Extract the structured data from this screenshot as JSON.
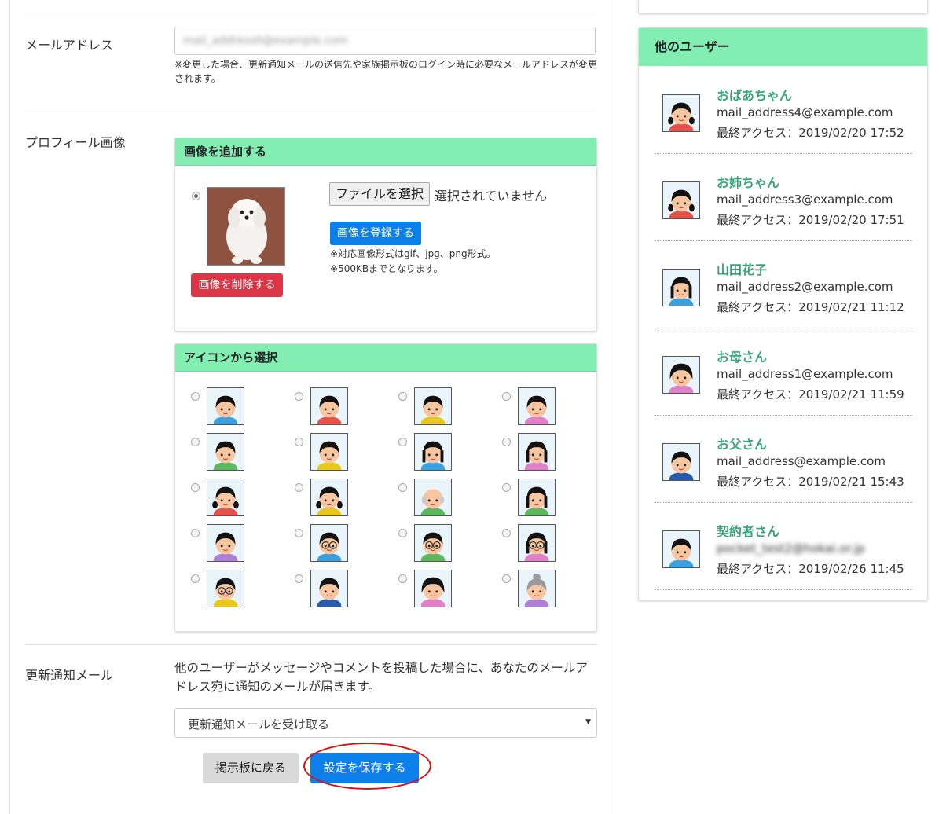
{
  "form": {
    "email": {
      "label": "メールアドレス",
      "value": "mail_address0@example.com",
      "note": "※変更した場合、更新通知メールの送信先や家族掲示板のログイン時に必要なメールアドレスが変更されます。"
    },
    "profile_image": {
      "label": "プロフィール画像",
      "upload_panel": {
        "title": "画像を追加する",
        "delete_button": "画像を削除する",
        "file_button": "ファイルを選択",
        "file_status": "選択されていません",
        "register_button": "画像を登録する",
        "note_formats": "※対応画像形式はgif、jpg、png形式。",
        "note_size": "※500KBまでとなります。"
      },
      "icon_panel": {
        "title": "アイコンから選択",
        "icons": [
          {
            "name": "boy-blue",
            "hair": "#111",
            "shirt": "#3aa0e0",
            "face": "#f6c6a0"
          },
          {
            "name": "boy-red",
            "hair": "#111",
            "shirt": "#e8504a",
            "face": "#f6c6a0"
          },
          {
            "name": "girl-bob-yellow",
            "hair": "#111",
            "shirt": "#e8c81a",
            "face": "#f6c6a0"
          },
          {
            "name": "girl-pink",
            "hair": "#111",
            "shirt": "#e080c8",
            "face": "#f6c6a0"
          },
          {
            "name": "boy-spiky-green",
            "hair": "#111",
            "shirt": "#5cb85c",
            "face": "#f6c6a0"
          },
          {
            "name": "boy-spiky-yellow",
            "hair": "#111",
            "shirt": "#e8c81a",
            "face": "#f6c6a0"
          },
          {
            "name": "girl-long-blue",
            "hair": "#111",
            "shirt": "#3aa0e0",
            "face": "#f6c6a0"
          },
          {
            "name": "girl-long-pink",
            "hair": "#111",
            "shirt": "#e080c8",
            "face": "#f6c6a0"
          },
          {
            "name": "girl-pigtails-red",
            "hair": "#111",
            "shirt": "#e8504a",
            "face": "#f6c6a0"
          },
          {
            "name": "girl-pigtails-yellow",
            "hair": "#111",
            "shirt": "#e8c81a",
            "face": "#f6c6a0"
          },
          {
            "name": "grandpa-green",
            "hair": "#ccc",
            "shirt": "#5cb85c",
            "face": "#f6c6a0"
          },
          {
            "name": "woman-green",
            "hair": "#111",
            "shirt": "#5cb85c",
            "face": "#f6c6a0"
          },
          {
            "name": "girl-side-purple",
            "hair": "#111",
            "shirt": "#b080d8",
            "face": "#f6c6a0"
          },
          {
            "name": "boy-glasses-blue",
            "hair": "#111",
            "shirt": "#3aa0e0",
            "face": "#f6c6a0"
          },
          {
            "name": "boy-glasses-green",
            "hair": "#111",
            "shirt": "#5cb85c",
            "face": "#f6c6a0"
          },
          {
            "name": "woman-glasses-pink",
            "hair": "#111",
            "shirt": "#e080c8",
            "face": "#f6c6a0"
          },
          {
            "name": "girl-glasses-yellow",
            "hair": "#111",
            "shirt": "#e8c81a",
            "face": "#f6c6a0"
          },
          {
            "name": "man-suit",
            "hair": "#111",
            "shirt": "#2a5caa",
            "face": "#f6c6a0"
          },
          {
            "name": "girl-curly-pink",
            "hair": "#111",
            "shirt": "#e080c8",
            "face": "#f6c6a0"
          },
          {
            "name": "grandma-purple",
            "hair": "#999",
            "shirt": "#b080d8",
            "face": "#f6c6a0"
          }
        ]
      }
    },
    "notify": {
      "label": "更新通知メール",
      "description": "他のユーザーがメッセージやコメントを投稿した場合に、あなたのメールアドレス宛に通知のメールが届きます。",
      "selected": "更新通知メールを受け取る"
    },
    "buttons": {
      "back": "掲示板に戻る",
      "save": "設定を保存する"
    }
  },
  "sidebar": {
    "title": "他のユーザー",
    "users": [
      {
        "name": "おばあちゃん",
        "email": "mail_address4@example.com",
        "access": "最終アクセス：2019/02/20 17:52",
        "avatar": "girl-pigtails-red"
      },
      {
        "name": "お姉ちゃん",
        "email": "mail_address3@example.com",
        "access": "最終アクセス：2019/02/20 17:51",
        "avatar": "girl-pigtails-red"
      },
      {
        "name": "山田花子",
        "email": "mail_address2@example.com",
        "access": "最終アクセス：2019/02/21 11:12",
        "avatar": "girl-long-blue"
      },
      {
        "name": "お母さん",
        "email": "mail_address1@example.com",
        "access": "最終アクセス：2019/02/21 11:59",
        "avatar": "girl-curly-pink"
      },
      {
        "name": "お父さん",
        "email": "mail_address@example.com",
        "access": "最終アクセス：2019/02/21 15:43",
        "avatar": "man-suit"
      },
      {
        "name": "契約者さん",
        "email": "pocket_test2@hokai.or.jp",
        "access": "最終アクセス：2019/02/26 11:45",
        "avatar": "boy-blue"
      }
    ]
  }
}
